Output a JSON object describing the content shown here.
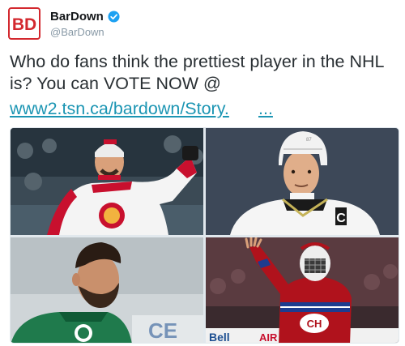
{
  "tweet": {
    "avatar_text": "BD",
    "display_name": "BarDown",
    "handle": "@BarDown",
    "verified": true,
    "text": "Who do fans think the prettiest player in the NHL is? You can VOTE NOW @",
    "link_text": "www2.tsn.ca/bardown/Story.",
    "ellipsis": "...",
    "colors": {
      "brand": "#d3282e",
      "link": "#1b95b3",
      "verified": "#1da1f2"
    }
  },
  "media": {
    "photos": [
      {
        "label": "Panthers player in white jersey celebrating, stadium crowd behind",
        "jersey_text": ""
      },
      {
        "label": "Penguins captain in white helmet and jersey",
        "jersey_text": "C"
      },
      {
        "label": "Bearded Stars player in green jersey, profile view",
        "jersey_text": ""
      },
      {
        "label": "Canadiens goalie in red jersey raising hand",
        "jersey_text": "CH"
      }
    ],
    "board_text": {
      "left": "CE",
      "right_1": "Bell",
      "right_2": "AIR"
    }
  }
}
